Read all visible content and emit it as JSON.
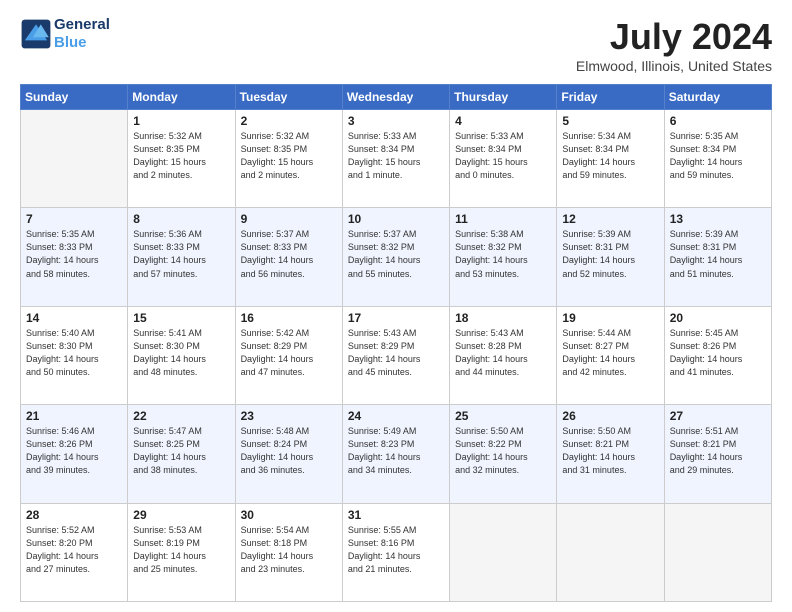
{
  "header": {
    "logo_line1": "General",
    "logo_line2": "Blue",
    "month_title": "July 2024",
    "location": "Elmwood, Illinois, United States"
  },
  "days_of_week": [
    "Sunday",
    "Monday",
    "Tuesday",
    "Wednesday",
    "Thursday",
    "Friday",
    "Saturday"
  ],
  "weeks": [
    [
      {
        "day": "",
        "info": ""
      },
      {
        "day": "1",
        "info": "Sunrise: 5:32 AM\nSunset: 8:35 PM\nDaylight: 15 hours\nand 2 minutes."
      },
      {
        "day": "2",
        "info": "Sunrise: 5:32 AM\nSunset: 8:35 PM\nDaylight: 15 hours\nand 2 minutes."
      },
      {
        "day": "3",
        "info": "Sunrise: 5:33 AM\nSunset: 8:34 PM\nDaylight: 15 hours\nand 1 minute."
      },
      {
        "day": "4",
        "info": "Sunrise: 5:33 AM\nSunset: 8:34 PM\nDaylight: 15 hours\nand 0 minutes."
      },
      {
        "day": "5",
        "info": "Sunrise: 5:34 AM\nSunset: 8:34 PM\nDaylight: 14 hours\nand 59 minutes."
      },
      {
        "day": "6",
        "info": "Sunrise: 5:35 AM\nSunset: 8:34 PM\nDaylight: 14 hours\nand 59 minutes."
      }
    ],
    [
      {
        "day": "7",
        "info": "Sunrise: 5:35 AM\nSunset: 8:33 PM\nDaylight: 14 hours\nand 58 minutes."
      },
      {
        "day": "8",
        "info": "Sunrise: 5:36 AM\nSunset: 8:33 PM\nDaylight: 14 hours\nand 57 minutes."
      },
      {
        "day": "9",
        "info": "Sunrise: 5:37 AM\nSunset: 8:33 PM\nDaylight: 14 hours\nand 56 minutes."
      },
      {
        "day": "10",
        "info": "Sunrise: 5:37 AM\nSunset: 8:32 PM\nDaylight: 14 hours\nand 55 minutes."
      },
      {
        "day": "11",
        "info": "Sunrise: 5:38 AM\nSunset: 8:32 PM\nDaylight: 14 hours\nand 53 minutes."
      },
      {
        "day": "12",
        "info": "Sunrise: 5:39 AM\nSunset: 8:31 PM\nDaylight: 14 hours\nand 52 minutes."
      },
      {
        "day": "13",
        "info": "Sunrise: 5:39 AM\nSunset: 8:31 PM\nDaylight: 14 hours\nand 51 minutes."
      }
    ],
    [
      {
        "day": "14",
        "info": "Sunrise: 5:40 AM\nSunset: 8:30 PM\nDaylight: 14 hours\nand 50 minutes."
      },
      {
        "day": "15",
        "info": "Sunrise: 5:41 AM\nSunset: 8:30 PM\nDaylight: 14 hours\nand 48 minutes."
      },
      {
        "day": "16",
        "info": "Sunrise: 5:42 AM\nSunset: 8:29 PM\nDaylight: 14 hours\nand 47 minutes."
      },
      {
        "day": "17",
        "info": "Sunrise: 5:43 AM\nSunset: 8:29 PM\nDaylight: 14 hours\nand 45 minutes."
      },
      {
        "day": "18",
        "info": "Sunrise: 5:43 AM\nSunset: 8:28 PM\nDaylight: 14 hours\nand 44 minutes."
      },
      {
        "day": "19",
        "info": "Sunrise: 5:44 AM\nSunset: 8:27 PM\nDaylight: 14 hours\nand 42 minutes."
      },
      {
        "day": "20",
        "info": "Sunrise: 5:45 AM\nSunset: 8:26 PM\nDaylight: 14 hours\nand 41 minutes."
      }
    ],
    [
      {
        "day": "21",
        "info": "Sunrise: 5:46 AM\nSunset: 8:26 PM\nDaylight: 14 hours\nand 39 minutes."
      },
      {
        "day": "22",
        "info": "Sunrise: 5:47 AM\nSunset: 8:25 PM\nDaylight: 14 hours\nand 38 minutes."
      },
      {
        "day": "23",
        "info": "Sunrise: 5:48 AM\nSunset: 8:24 PM\nDaylight: 14 hours\nand 36 minutes."
      },
      {
        "day": "24",
        "info": "Sunrise: 5:49 AM\nSunset: 8:23 PM\nDaylight: 14 hours\nand 34 minutes."
      },
      {
        "day": "25",
        "info": "Sunrise: 5:50 AM\nSunset: 8:22 PM\nDaylight: 14 hours\nand 32 minutes."
      },
      {
        "day": "26",
        "info": "Sunrise: 5:50 AM\nSunset: 8:21 PM\nDaylight: 14 hours\nand 31 minutes."
      },
      {
        "day": "27",
        "info": "Sunrise: 5:51 AM\nSunset: 8:21 PM\nDaylight: 14 hours\nand 29 minutes."
      }
    ],
    [
      {
        "day": "28",
        "info": "Sunrise: 5:52 AM\nSunset: 8:20 PM\nDaylight: 14 hours\nand 27 minutes."
      },
      {
        "day": "29",
        "info": "Sunrise: 5:53 AM\nSunset: 8:19 PM\nDaylight: 14 hours\nand 25 minutes."
      },
      {
        "day": "30",
        "info": "Sunrise: 5:54 AM\nSunset: 8:18 PM\nDaylight: 14 hours\nand 23 minutes."
      },
      {
        "day": "31",
        "info": "Sunrise: 5:55 AM\nSunset: 8:16 PM\nDaylight: 14 hours\nand 21 minutes."
      },
      {
        "day": "",
        "info": ""
      },
      {
        "day": "",
        "info": ""
      },
      {
        "day": "",
        "info": ""
      }
    ]
  ]
}
